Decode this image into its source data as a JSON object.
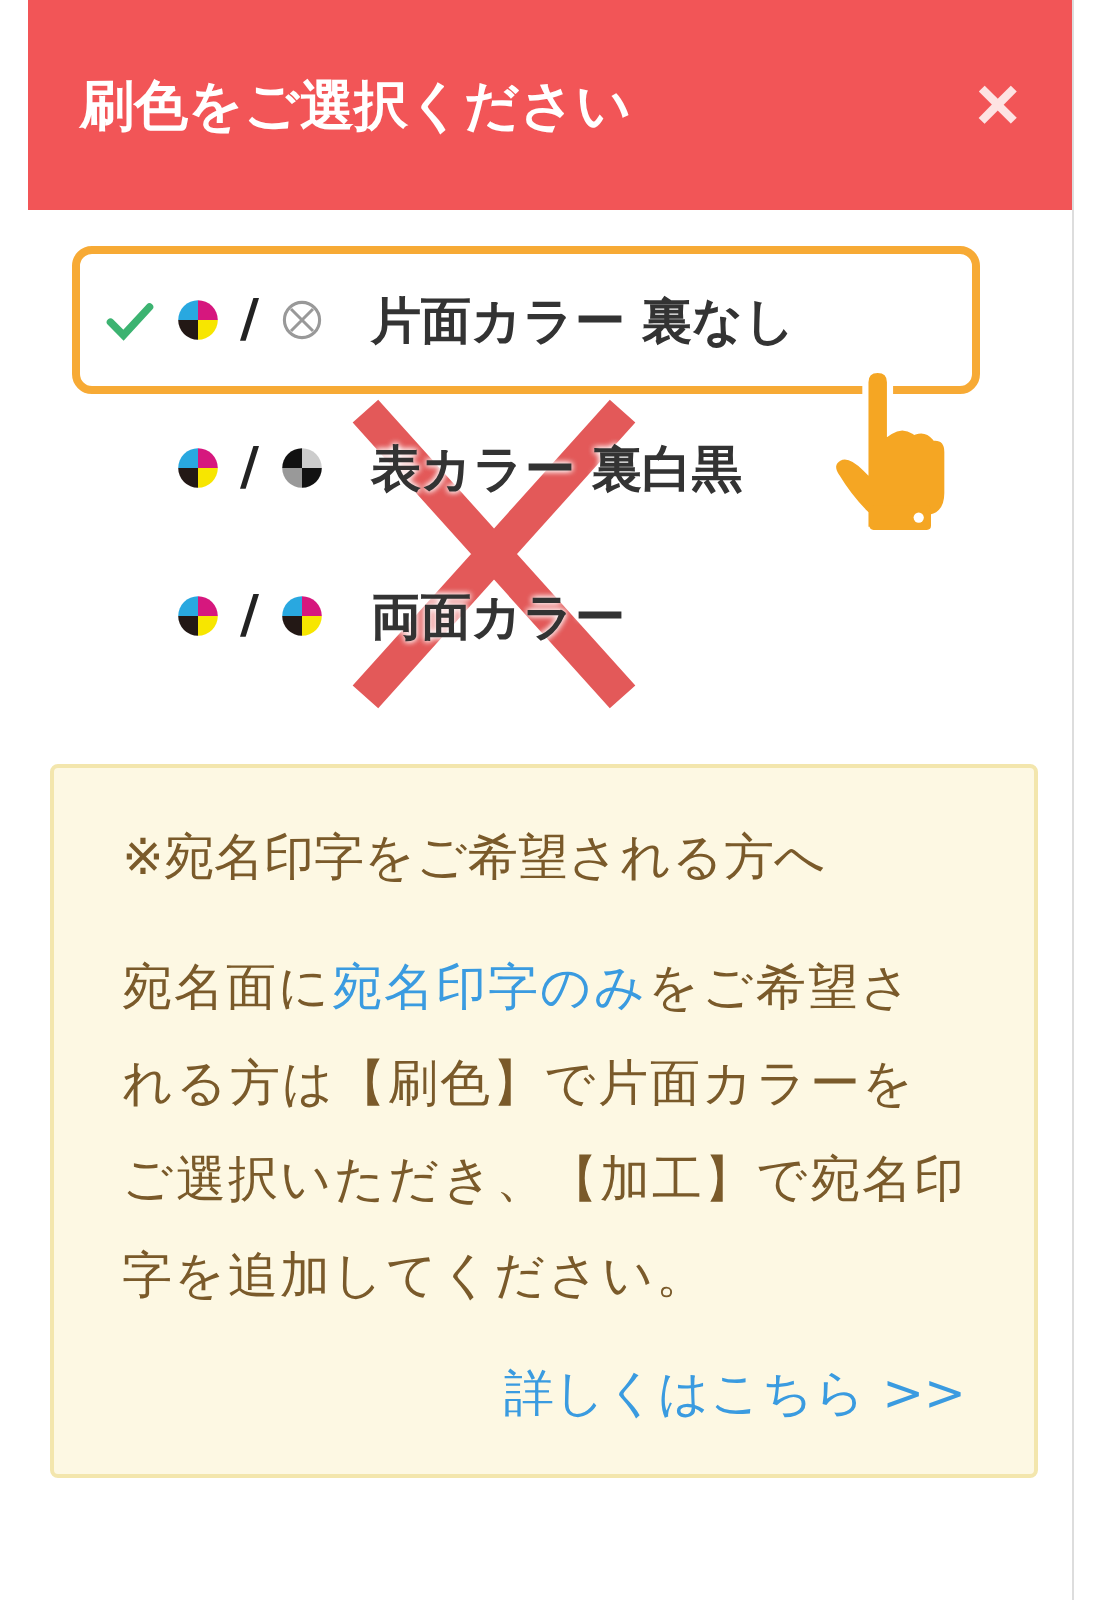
{
  "header": {
    "title": "刷色をご選択ください",
    "close": "×"
  },
  "options": [
    {
      "label": "片面カラー 裏なし",
      "separator": "/",
      "kind": "none",
      "selected": true
    },
    {
      "label": "表カラー 裏白黒",
      "separator": "/",
      "kind": "mono",
      "selected": false
    },
    {
      "label": "両面カラー",
      "separator": "/",
      "kind": "color",
      "selected": false
    }
  ],
  "note": {
    "heading": "※宛名印字をご希望される方へ",
    "body_before": "宛名面に",
    "body_link": "宛名印字のみ",
    "body_after": "をご希望される方は【刷色】で片面カラーをご選択いただき、【加工】で宛名印字を追加してください。",
    "more_link": "詳しくはこちら >>"
  }
}
